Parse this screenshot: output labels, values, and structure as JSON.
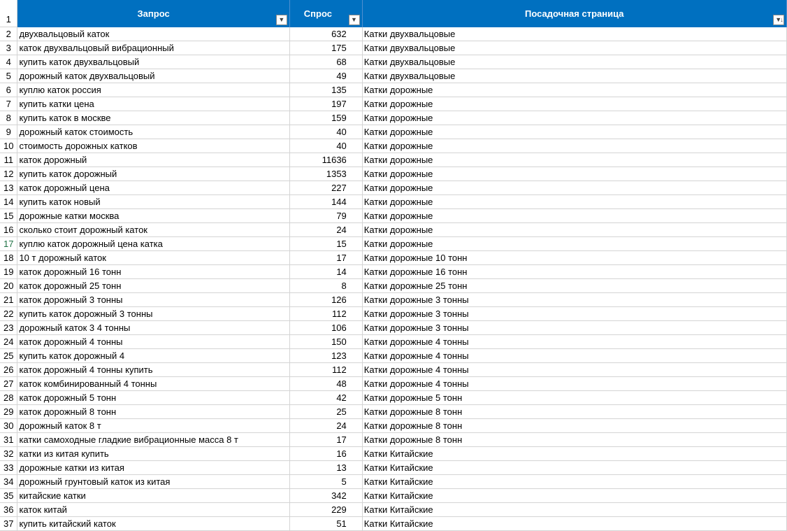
{
  "header": {
    "row_number": "1",
    "columns": [
      "Запрос",
      "Спрос",
      "Посадочная страница"
    ]
  },
  "active_row": "17",
  "rows": [
    {
      "n": "2",
      "q": "двухвальцовый каток",
      "d": "632",
      "p": "Катки двухвальцовые"
    },
    {
      "n": "3",
      "q": "каток двухвальцовый вибрационный",
      "d": "175",
      "p": "Катки двухвальцовые"
    },
    {
      "n": "4",
      "q": "купить каток двухвальцовый",
      "d": "68",
      "p": "Катки двухвальцовые"
    },
    {
      "n": "5",
      "q": "дорожный каток двухвальцовый",
      "d": "49",
      "p": "Катки двухвальцовые"
    },
    {
      "n": "6",
      "q": "куплю каток россия",
      "d": "135",
      "p": "Катки дорожные"
    },
    {
      "n": "7",
      "q": "купить катки цена",
      "d": "197",
      "p": "Катки дорожные"
    },
    {
      "n": "8",
      "q": "купить каток в москве",
      "d": "159",
      "p": "Катки дорожные"
    },
    {
      "n": "9",
      "q": "дорожный каток стоимость",
      "d": "40",
      "p": "Катки дорожные"
    },
    {
      "n": "10",
      "q": "стоимость дорожных катков",
      "d": "40",
      "p": "Катки дорожные"
    },
    {
      "n": "11",
      "q": "каток дорожный",
      "d": "11636",
      "p": "Катки дорожные"
    },
    {
      "n": "12",
      "q": "купить каток дорожный",
      "d": "1353",
      "p": "Катки дорожные"
    },
    {
      "n": "13",
      "q": "каток дорожный цена",
      "d": "227",
      "p": "Катки дорожные"
    },
    {
      "n": "14",
      "q": "купить каток новый",
      "d": "144",
      "p": "Катки дорожные"
    },
    {
      "n": "15",
      "q": "дорожные катки москва",
      "d": "79",
      "p": "Катки дорожные"
    },
    {
      "n": "16",
      "q": "сколько стоит дорожный каток",
      "d": "24",
      "p": "Катки дорожные"
    },
    {
      "n": "17",
      "q": "куплю каток дорожный цена катка",
      "d": "15",
      "p": "Катки дорожные"
    },
    {
      "n": "18",
      "q": "10 т дорожный каток",
      "d": "17",
      "p": "Катки дорожные 10 тонн"
    },
    {
      "n": "19",
      "q": "каток дорожный 16 тонн",
      "d": "14",
      "p": "Катки дорожные 16 тонн"
    },
    {
      "n": "20",
      "q": "каток дорожный 25 тонн",
      "d": "8",
      "p": "Катки дорожные 25 тонн"
    },
    {
      "n": "21",
      "q": "каток дорожный 3 тонны",
      "d": "126",
      "p": "Катки дорожные 3 тонны"
    },
    {
      "n": "22",
      "q": "купить каток дорожный 3 тонны",
      "d": "112",
      "p": "Катки дорожные 3 тонны"
    },
    {
      "n": "23",
      "q": "дорожный каток 3 4 тонны",
      "d": "106",
      "p": "Катки дорожные 3 тонны"
    },
    {
      "n": "24",
      "q": "каток дорожный 4 тонны",
      "d": "150",
      "p": "Катки дорожные 4 тонны"
    },
    {
      "n": "25",
      "q": "купить каток дорожный 4",
      "d": "123",
      "p": "Катки дорожные 4 тонны"
    },
    {
      "n": "26",
      "q": "каток дорожный 4 тонны купить",
      "d": "112",
      "p": "Катки дорожные 4 тонны"
    },
    {
      "n": "27",
      "q": "каток комбинированный 4 тонны",
      "d": "48",
      "p": "Катки дорожные 4 тонны"
    },
    {
      "n": "28",
      "q": "каток дорожный 5 тонн",
      "d": "42",
      "p": "Катки дорожные 5 тонн"
    },
    {
      "n": "29",
      "q": "каток дорожный 8 тонн",
      "d": "25",
      "p": "Катки дорожные 8 тонн"
    },
    {
      "n": "30",
      "q": "дорожный каток 8 т",
      "d": "24",
      "p": "Катки дорожные 8 тонн"
    },
    {
      "n": "31",
      "q": "катки самоходные гладкие вибрационные масса 8 т",
      "d": "17",
      "p": "Катки дорожные 8 тонн"
    },
    {
      "n": "32",
      "q": "катки из китая купить",
      "d": "16",
      "p": "Катки Китайские"
    },
    {
      "n": "33",
      "q": "дорожные катки из китая",
      "d": "13",
      "p": "Катки Китайские"
    },
    {
      "n": "34",
      "q": "дорожный грунтовый каток из китая",
      "d": "5",
      "p": "Катки Китайские"
    },
    {
      "n": "35",
      "q": "китайские катки",
      "d": "342",
      "p": "Катки Китайские"
    },
    {
      "n": "36",
      "q": "каток китай",
      "d": "229",
      "p": "Катки Китайские"
    },
    {
      "n": "37",
      "q": "купить китайский каток",
      "d": "51",
      "p": "Катки Китайские"
    }
  ]
}
